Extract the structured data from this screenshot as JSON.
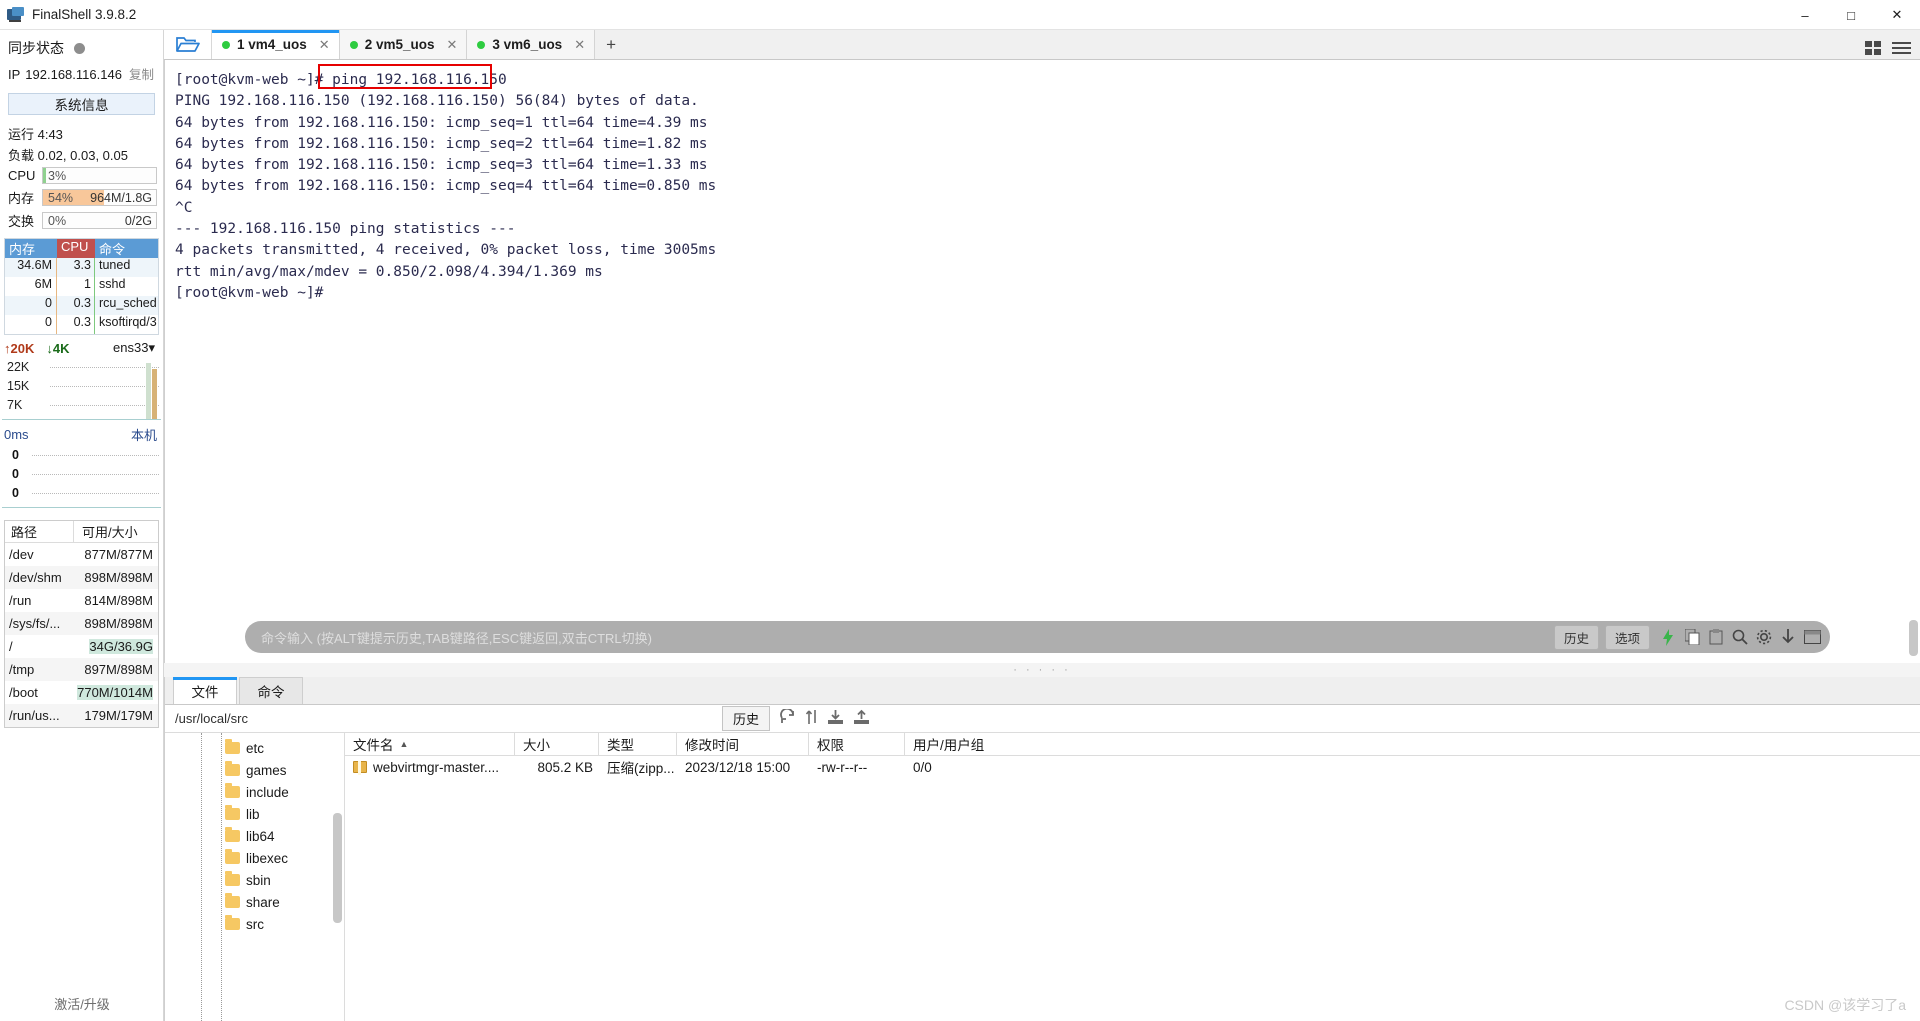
{
  "window": {
    "title": "FinalShell 3.9.8.2",
    "app_icon": "monitor-icon",
    "minimize": "–",
    "maximize": "□",
    "close": "✕"
  },
  "sidebar": {
    "sync_label": "同步状态",
    "ip_key": "IP",
    "ip_value": "192.168.116.146",
    "copy_label": "复制",
    "sysinfo_button": "系统信息",
    "uptime": "运行 4:43",
    "load": "负载 0.02, 0.03, 0.05",
    "gauges": [
      {
        "name": "CPU",
        "percent": "3%",
        "right": "",
        "fill_pct": 3,
        "color": "#8fd18f"
      },
      {
        "name": "内存",
        "percent": "54%",
        "right": "964M/1.8G",
        "fill_pct": 54,
        "color": "#f8c79a"
      },
      {
        "name": "交换",
        "percent": "0%",
        "right": "0/2G",
        "fill_pct": 0,
        "color": "#cfe8dd"
      }
    ],
    "process_table": {
      "headers": [
        "内存",
        "CPU",
        "命令"
      ],
      "rows": [
        {
          "mem": "34.6M",
          "cpu": "3.3",
          "cmd": "tuned"
        },
        {
          "mem": "6M",
          "cpu": "1",
          "cmd": "sshd"
        },
        {
          "mem": "0",
          "cpu": "0.3",
          "cmd": "rcu_sched"
        },
        {
          "mem": "0",
          "cpu": "0.3",
          "cmd": "ksoftirqd/3"
        }
      ]
    },
    "network": {
      "upload": "20K",
      "download": "4K",
      "interface": "ens33",
      "up_arrow": "↑",
      "down_arrow": "↓",
      "chevron": "▾",
      "y_labels": [
        "22K",
        "15K",
        "7K"
      ]
    },
    "latency": {
      "value": "0ms",
      "target": "本机",
      "y_labels": [
        "0",
        "0",
        "0"
      ]
    },
    "disk_table": {
      "headers": [
        "路径",
        "可用/大小"
      ],
      "rows": [
        {
          "path": "/dev",
          "size": "877M/877M",
          "highlight": false
        },
        {
          "path": "/dev/shm",
          "size": "898M/898M",
          "highlight": false
        },
        {
          "path": "/run",
          "size": "814M/898M",
          "highlight": false
        },
        {
          "path": "/sys/fs/...",
          "size": "898M/898M",
          "highlight": false
        },
        {
          "path": "/",
          "size": "34G/36.9G",
          "highlight": true
        },
        {
          "path": "/tmp",
          "size": "897M/898M",
          "highlight": false
        },
        {
          "path": "/boot",
          "size": "770M/1014M",
          "highlight": true
        },
        {
          "path": "/run/us...",
          "size": "179M/179M",
          "highlight": false
        }
      ]
    },
    "activate_label": "激活/升级"
  },
  "tabbar": {
    "open_icon": "folder-open-icon",
    "tabs": [
      {
        "label": "1 vm4_uos",
        "active": true,
        "close": "✕"
      },
      {
        "label": "2 vm5_uos",
        "active": false,
        "close": "✕"
      },
      {
        "label": "3 vm6_uos",
        "active": false,
        "close": "✕"
      }
    ],
    "new_tab": "+",
    "grid_icon": "grid-view-icon",
    "menu_icon": "hamburger-menu-icon"
  },
  "terminal": {
    "highlighted_command": "ping 192.168.116.150",
    "lines": [
      "[root@kvm-web ~]# ping 192.168.116.150",
      "PING 192.168.116.150 (192.168.116.150) 56(84) bytes of data.",
      "64 bytes from 192.168.116.150: icmp_seq=1 ttl=64 time=4.39 ms",
      "64 bytes from 192.168.116.150: icmp_seq=2 ttl=64 time=1.82 ms",
      "64 bytes from 192.168.116.150: icmp_seq=3 ttl=64 time=1.33 ms",
      "64 bytes from 192.168.116.150: icmp_seq=4 ttl=64 time=0.850 ms",
      "^C",
      "--- 192.168.116.150 ping statistics ---",
      "4 packets transmitted, 4 received, 0% packet loss, time 3005ms",
      "rtt min/avg/max/mdev = 0.850/2.098/4.394/1.369 ms",
      "[root@kvm-web ~]#"
    ]
  },
  "command_bar": {
    "placeholder": "命令输入 (按ALT键提示历史,TAB键路径,ESC键返回,双击CTRL切换)",
    "history_button": "历史",
    "options_button": "选项",
    "icons": [
      "lightning-icon",
      "copy-icon",
      "paste-icon",
      "search-icon",
      "gear-icon",
      "download-icon",
      "window-icon"
    ]
  },
  "bottom_panel": {
    "tabs": [
      {
        "label": "文件",
        "active": true
      },
      {
        "label": "命令",
        "active": false
      }
    ],
    "path": "/usr/local/src",
    "history_button": "历史",
    "toolbar_icons": [
      "refresh-icon",
      "sort-icon",
      "download-icon",
      "upload-icon"
    ],
    "tree_nodes": [
      "etc",
      "games",
      "include",
      "lib",
      "lib64",
      "libexec",
      "sbin",
      "share",
      "src"
    ],
    "file_columns": [
      "文件名",
      "大小",
      "类型",
      "修改时间",
      "权限",
      "用户/用户组"
    ],
    "sort_indicator": "▲",
    "files": [
      {
        "name": "webvirtmgr-master....",
        "size": "805.2 KB",
        "type": "压缩(zipp...",
        "modified": "2023/12/18 15:00",
        "permissions": "-rw-r--r--",
        "owner": "0/0"
      }
    ]
  },
  "watermark": "CSDN @该学习了a"
}
